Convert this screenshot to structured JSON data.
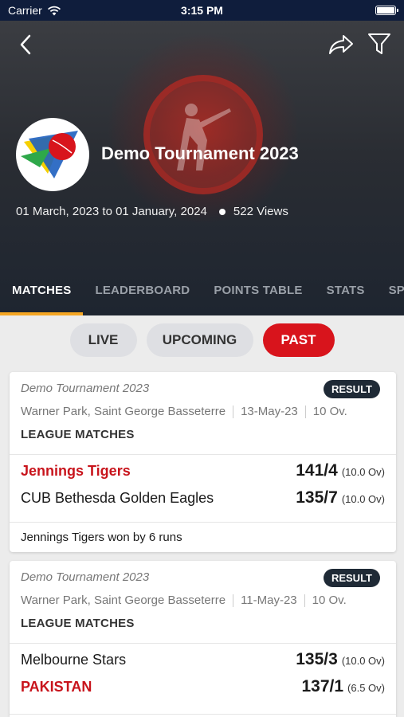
{
  "status_bar": {
    "carrier": "Carrier",
    "time": "3:15 PM"
  },
  "tournament": {
    "title": "Demo Tournament 2023",
    "dates": "01 March, 2023 to 01 January, 2024",
    "views": "522 Views"
  },
  "tabs": [
    "MATCHES",
    "LEADERBOARD",
    "POINTS TABLE",
    "STATS",
    "SPON"
  ],
  "filters": [
    "LIVE",
    "UPCOMING",
    "PAST"
  ],
  "matches": [
    {
      "tournament": "Demo Tournament 2023",
      "badge": "RESULT",
      "venue": "Warner Park, Saint George Basseterre",
      "date": "13-May-23",
      "overs": "10 Ov.",
      "stage": "LEAGUE MATCHES",
      "team1": {
        "name": "Jennings Tigers",
        "score": "141/4",
        "overs": "(10.0 Ov)"
      },
      "team2": {
        "name": "CUB Bethesda Golden Eagles",
        "score": "135/7",
        "overs": "(10.0 Ov)"
      },
      "result": "Jennings Tigers won by 6 runs"
    },
    {
      "tournament": "Demo Tournament 2023",
      "badge": "RESULT",
      "venue": "Warner Park, Saint George Basseterre",
      "date": "11-May-23",
      "overs": "10 Ov.",
      "stage": "LEAGUE MATCHES",
      "team1": {
        "name": "Melbourne Stars",
        "score": "135/3",
        "overs": "(10.0 Ov)"
      },
      "team2": {
        "name": "PAKISTAN",
        "score": "137/1",
        "overs": "(6.5 Ov)"
      }
    }
  ],
  "colors": {
    "accent": "#d8141c",
    "tab_indicator": "#f5a623",
    "status_bar": "#0f1d3c"
  }
}
